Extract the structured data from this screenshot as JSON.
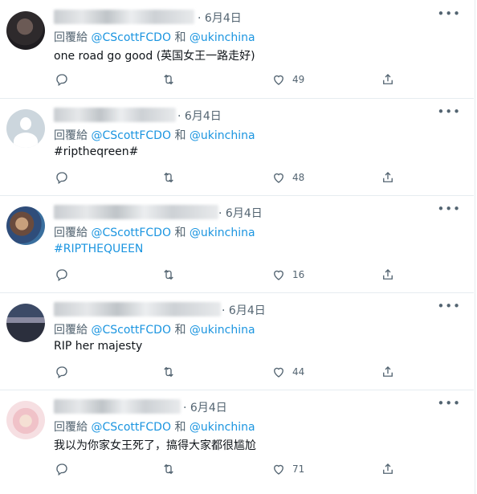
{
  "tweets": [
    {
      "date": "6月4日",
      "reply_prefix": "回覆給",
      "mention1": "@CScottFCDO",
      "conj": "和",
      "mention2": "@ukinchina",
      "text": "one road go good (英国女王一路走好)",
      "likes": "49",
      "avatar": "dark-portrait"
    },
    {
      "date": "6月4日",
      "reply_prefix": "回覆給",
      "mention1": "@CScottFCDO",
      "conj": "和",
      "mention2": "@ukinchina",
      "text": "#riptheqreen#",
      "likes": "48",
      "avatar": "default-profile"
    },
    {
      "date": "6月4日",
      "reply_prefix": "回覆給",
      "mention1": "@CScottFCDO",
      "conj": "和",
      "mention2": "@ukinchina",
      "text": "#RIPTHEQUEEN",
      "likes": "16",
      "avatar": "color-portrait"
    },
    {
      "date": "6月4日",
      "reply_prefix": "回覆給",
      "mention1": "@CScottFCDO",
      "conj": "和",
      "mention2": "@ukinchina",
      "text": "RIP her majesty",
      "likes": "44",
      "avatar": "crowd-photo"
    },
    {
      "date": "6月4日",
      "reply_prefix": "回覆給",
      "mention1": "@CScottFCDO",
      "conj": "和",
      "mention2": "@ukinchina",
      "text": "我以为你家女王死了，搞得大家都很尴尬",
      "likes": "71",
      "avatar": "anime-girl"
    }
  ],
  "icons": {
    "reply": "reply-icon",
    "retweet": "retweet-icon",
    "like": "heart-icon",
    "share": "share-icon",
    "more": "more-options-icon"
  },
  "colors": {
    "mention": "#1b95e0",
    "secondary_text": "#536471",
    "primary_text": "#0f1419",
    "divider": "#e6ecf0"
  }
}
